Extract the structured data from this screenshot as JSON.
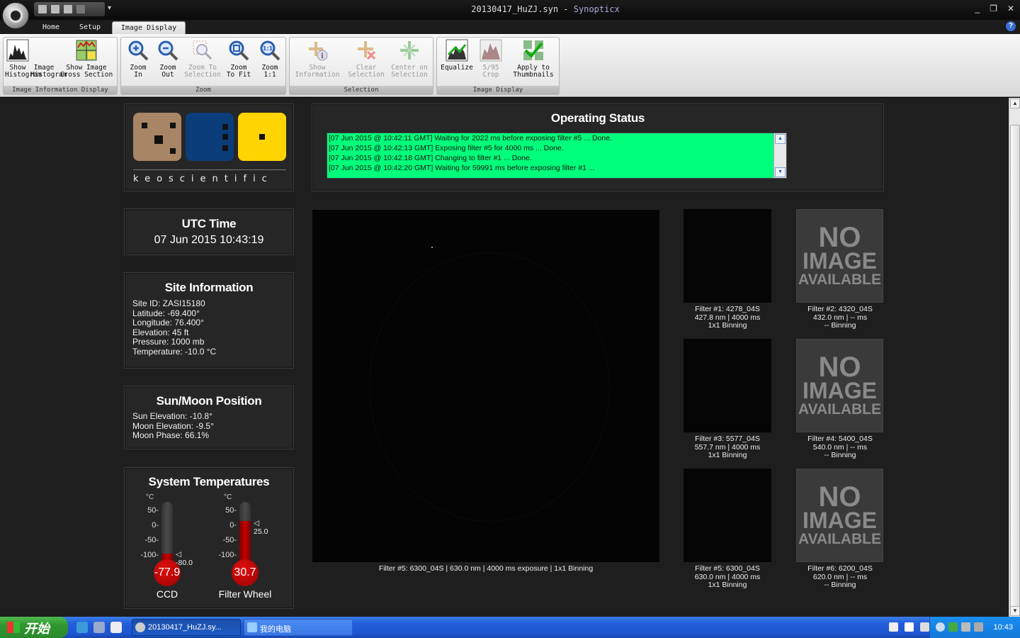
{
  "window": {
    "title_file": "20130417_HuZJ.syn",
    "title_sep": " - ",
    "title_app": "Synopticx",
    "minimize": "_",
    "restore": "❐",
    "close": "✕"
  },
  "ribbon": {
    "tabs": [
      {
        "label": "Home"
      },
      {
        "label": "Setup"
      },
      {
        "label": "Image Display"
      }
    ],
    "groups": [
      {
        "label": "Image Information Display",
        "buttons": [
          {
            "label1": "Show",
            "label2": "Histogram",
            "icon": "histogram-icon"
          },
          {
            "label1": "Image",
            "label2": "Histogram",
            "icon": "histogram-icon"
          },
          {
            "label1": "Show Image",
            "label2": "Cross Section",
            "icon": "cross-section-icon"
          }
        ]
      },
      {
        "label": "Zoom",
        "buttons": [
          {
            "label1": "Zoom",
            "label2": "In",
            "icon": "zoom-in-icon"
          },
          {
            "label1": "Zoom",
            "label2": "Out",
            "icon": "zoom-out-icon"
          },
          {
            "label1": "Zoom To",
            "label2": "Selection",
            "icon": "zoom-selection-icon"
          },
          {
            "label1": "Zoom",
            "label2": "To Fit",
            "icon": "zoom-fit-icon"
          },
          {
            "label1": "Zoom",
            "label2": "1:1",
            "icon": "zoom-1-1-icon"
          }
        ]
      },
      {
        "label": "Selection",
        "buttons": [
          {
            "label1": "Show",
            "label2": "Information",
            "icon": "info-icon"
          },
          {
            "label1": "Clear",
            "label2": "Selection",
            "icon": "clear-selection-icon"
          },
          {
            "label1": "Center on",
            "label2": "Selection",
            "icon": "center-selection-icon"
          }
        ]
      },
      {
        "label": "Image Display",
        "buttons": [
          {
            "label1": "Equalize",
            "label2": "",
            "icon": "equalize-icon"
          },
          {
            "label1": "5/95",
            "label2": "Crop",
            "icon": "crop-icon"
          },
          {
            "label1": "Apply to",
            "label2": "Thumbnails",
            "icon": "apply-thumbnails-icon"
          }
        ]
      }
    ]
  },
  "logo": {
    "text": "keoscientific"
  },
  "operating_status": {
    "title": "Operating Status",
    "log": [
      "[07 Jun 2015 @ 10:42:11 GMT] Waiting for 2022 ms before exposing filter #5 ... Done.",
      "[07 Jun 2015 @ 10:42:13 GMT] Exposing filter #5 for 4000 ms ... Done.",
      "[07 Jun 2015 @ 10:42:18 GMT] Changing to filter #1 ... Done.",
      "[07 Jun 2015 @ 10:42:20 GMT] Waiting for 59991 ms before exposing filter #1 ..."
    ],
    "bg_color": "#00ff7a"
  },
  "utc": {
    "title": "UTC Time",
    "value": "07 Jun 2015 10:43:19"
  },
  "site": {
    "title": "Site Information",
    "lines": [
      "Site ID: ZASI15180",
      "Latitude: -69.400°",
      "Longitude: 76.400°",
      "Elevation: 45 ft",
      "Pressure: 1000 mb",
      "Temperature: -10.0 °C"
    ]
  },
  "sunmoon": {
    "title": "Sun/Moon Position",
    "lines": [
      "Sun Elevation: -10.8°",
      "Moon Elevation: -9.5°",
      "Moon Phase: 66.1%"
    ]
  },
  "temps": {
    "title": "System Temperatures",
    "unit": "°C",
    "ticks": [
      "50-",
      "0-",
      "-50-",
      "-100-"
    ],
    "ccd": {
      "name": "CCD",
      "value": "-77.9",
      "setpoint": "◁ -80.0",
      "level": -77.9
    },
    "wheel": {
      "name": "Filter Wheel",
      "value": "30.7",
      "setpoint": "◁ 25.0",
      "level": 30.7
    }
  },
  "main_image": {
    "caption": "Filter #5: 6300_04S  |  630.0 nm  |  4000 ms exposure  |  1x1 Binning"
  },
  "thumbs": [
    {
      "l1": "Filter #1: 4278_04S",
      "l2": "427.8 nm  |  4000 ms",
      "l3": "1x1 Binning",
      "image": true
    },
    {
      "l1": "Filter #2: 4320_04S",
      "l2": "432.0 nm  |  -- ms",
      "l3": "-- Binning",
      "image": false
    },
    {
      "l1": "Filter #3: 5577_04S",
      "l2": "557.7 nm  |  4000 ms",
      "l3": "1x1 Binning",
      "image": true
    },
    {
      "l1": "Filter #4: 5400_04S",
      "l2": "540.0 nm  |  -- ms",
      "l3": "-- Binning",
      "image": false
    },
    {
      "l1": "Filter #5: 6300_04S",
      "l2": "630.0 nm  |  4000 ms",
      "l3": "1x1 Binning",
      "image": true
    },
    {
      "l1": "Filter #6: 6200_04S",
      "l2": "620.0 nm  |  -- ms",
      "l3": "-- Binning",
      "image": false
    }
  ],
  "no_image": {
    "l1": "NO",
    "l2": "IMAGE",
    "l3": "AVAILABLE"
  },
  "taskbar": {
    "start": "开始",
    "tasks": [
      "20130417_HuZJ.sy...",
      "我的电脑"
    ],
    "clock": "10:43"
  }
}
